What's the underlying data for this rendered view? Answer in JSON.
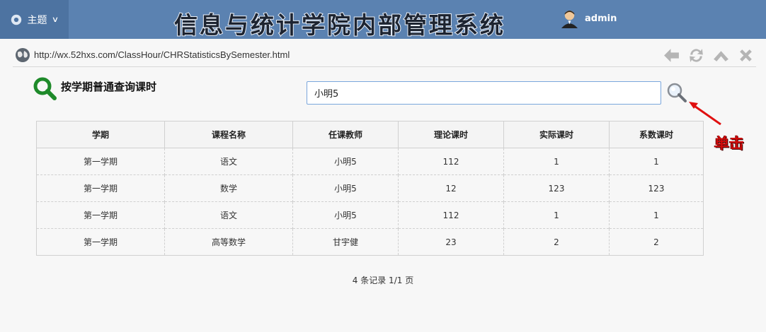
{
  "topbar": {
    "theme_label": "主题",
    "app_title": "信息与统计学院内部管理系统",
    "username": "admin"
  },
  "address": {
    "url": "http://wx.52hxs.com/ClassHour/CHRStatisticsBySemester.html"
  },
  "query": {
    "title": "按学期普通查询课时",
    "search_value": "小明5",
    "callout": "单击"
  },
  "table": {
    "headers": [
      "学期",
      "课程名称",
      "任课教师",
      "理论课时",
      "实际课时",
      "系数课时"
    ],
    "rows": [
      [
        "第一学期",
        "语文",
        "小明5",
        "112",
        "1",
        "1"
      ],
      [
        "第一学期",
        "数学",
        "小明5",
        "12",
        "123",
        "123"
      ],
      [
        "第一学期",
        "语文",
        "小明5",
        "112",
        "1",
        "1"
      ],
      [
        "第一学期",
        "高等数学",
        "甘宇健",
        "23",
        "2",
        "2"
      ]
    ]
  },
  "pager": {
    "text": "4 条记录 1/1 页"
  },
  "colors": {
    "topbar": "#5b82b1",
    "accent_red": "#d10a0a",
    "search_icon_green": "#1e8a2a"
  },
  "icons": [
    "gear-icon",
    "chevron-down-icon",
    "avatar",
    "globe-icon",
    "back-arrow-icon",
    "refresh-icon",
    "collapse-up-icon",
    "close-icon",
    "magnifier-icon",
    "search-icon"
  ]
}
